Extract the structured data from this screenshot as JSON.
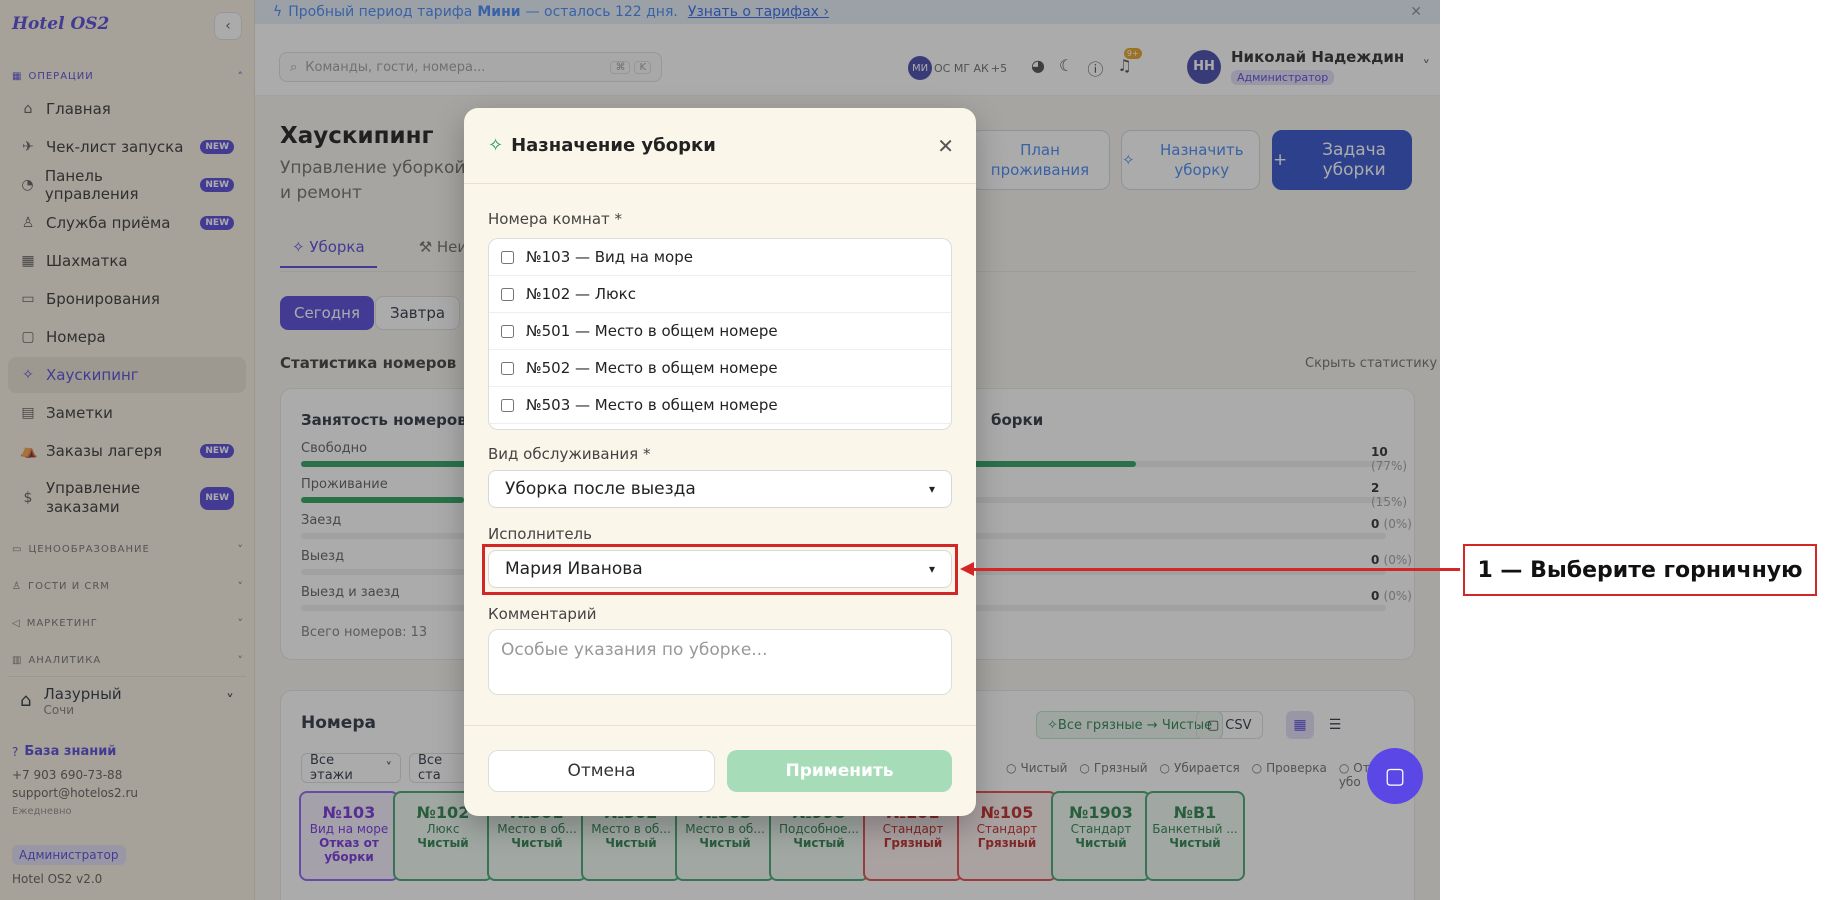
{
  "sidebar": {
    "logo": "Hotel OS2",
    "collapse": "‹",
    "sections": {
      "operations": "ОПЕРАЦИИ",
      "pricing": "ЦЕНООБРАЗОВАНИЕ",
      "guests": "ГОСТИ И CRM",
      "marketing": "МАРКЕТИНГ",
      "analytics": "АНАЛИТИКА"
    },
    "items": [
      {
        "label": "Главная",
        "icon": "⌂",
        "new": ""
      },
      {
        "label": "Чек-лист запуска",
        "icon": "✈",
        "new": "NEW"
      },
      {
        "label": "Панель управления",
        "icon": "◔",
        "new": "NEW"
      },
      {
        "label": "Служба приёма",
        "icon": "♙",
        "new": "NEW"
      },
      {
        "label": "Шахматка",
        "icon": "▦",
        "new": ""
      },
      {
        "label": "Бронирования",
        "icon": "▭",
        "new": ""
      },
      {
        "label": "Номера",
        "icon": "▢",
        "new": ""
      },
      {
        "label": "Хаускипинг",
        "icon": "✧",
        "new": ""
      },
      {
        "label": "Заметки",
        "icon": "▤",
        "new": ""
      },
      {
        "label": "Заказы лагеря",
        "icon": "⛺",
        "new": "NEW"
      },
      {
        "label": "Управление заказами",
        "icon": "$",
        "new": "NEW"
      }
    ],
    "hotel": {
      "name": "Лазурный",
      "city": "Сочи"
    },
    "kb": "База знаний",
    "phone": "+7 903 690-73-88",
    "email": "support@hotelos2.ru",
    "schedule": "Ежедневно",
    "role": "Администратор",
    "version": "Hotel OS2 v2.0"
  },
  "banner": {
    "text_a": "Пробный период тарифа",
    "plan": "Мини",
    "text_b": "— осталось 122 дня.",
    "link": "Узнать о тарифах ›",
    "close": "✕"
  },
  "topbar": {
    "search_placeholder": "Команды, гости, номера...",
    "kbd1": "⌘",
    "kbd2": "K",
    "avatars_a": "МИ",
    "avatars_b": "ОС МГ АК",
    "avatars_more": "+5",
    "notif_count": "9+",
    "user_initials": "НН",
    "user_name": "Николай Надеждин",
    "user_role": "Администратор"
  },
  "page": {
    "title": "Хаускипинг",
    "subtitle": "Управление уборкой и ремонт",
    "btn_plan": "План проживания",
    "btn_assign": "Назначить уборку",
    "btn_task": "Задача уборки",
    "tab_cleaning": "Уборка",
    "tab_repair": "Неи",
    "today": "Сегодня",
    "tomorrow": "Завтра",
    "stats_title": "Статистика номеров",
    "hide_stats": "Скрыть статистику",
    "occupancy_title": "Занятость номеров",
    "cleaning_title": "борки",
    "rows": [
      {
        "label": "Свободно",
        "value": "10",
        "pct": "(77%)",
        "fill": 0.77
      },
      {
        "label": "Проживание",
        "value": "2",
        "pct": "(15%)",
        "fill": 0.15
      },
      {
        "label": "Заезд",
        "value": "0",
        "pct": "(0%)",
        "fill": 0
      },
      {
        "label": "Выезд",
        "value": "0",
        "pct": "(0%)",
        "fill": 0
      },
      {
        "label": "Выезд и заезд",
        "value": "0",
        "pct": "(0%)",
        "fill": 0
      }
    ],
    "total_rooms": "Всего номеров: 13",
    "rooms_title": "Номера",
    "all_dirty": "Все грязные → Чистые",
    "csv": "CSV",
    "filter_floors": "Все этажи",
    "filter_status": "Все ста",
    "legend": [
      "Чистый",
      "Грязный",
      "Убирается",
      "Проверка",
      "Отказ от убо"
    ],
    "room_cards": [
      {
        "no": "№103",
        "type": "Вид на море",
        "status": "Отказ от уборки",
        "color": "purple"
      },
      {
        "no": "№102",
        "type": "Люкс",
        "status": "Чистый",
        "color": "green"
      },
      {
        "no": "№501",
        "type": "Место в об...",
        "status": "Чистый",
        "color": "green"
      },
      {
        "no": "№502",
        "type": "Место в об...",
        "status": "Чистый",
        "color": "green"
      },
      {
        "no": "№503",
        "type": "Место в об...",
        "status": "Чистый",
        "color": "green"
      },
      {
        "no": "№998",
        "type": "Подсобное...",
        "status": "Чистый",
        "color": "green"
      },
      {
        "no": "№101",
        "type": "Стандарт",
        "status": "Грязный",
        "color": "red"
      },
      {
        "no": "№105",
        "type": "Стандарт",
        "status": "Грязный",
        "color": "red"
      },
      {
        "no": "№1903",
        "type": "Стандарт",
        "status": "Чистый",
        "color": "green"
      },
      {
        "no": "№B1",
        "type": "Банкетный ...",
        "status": "Чистый",
        "color": "green"
      }
    ]
  },
  "modal": {
    "title": "Назначение уборки",
    "rooms_label": "Номера комнат *",
    "rooms": [
      "№103 — Вид на море",
      "№102 — Люкс",
      "№501 — Место в общем номере",
      "№502 — Место в общем номере",
      "№503 — Место в общем номере"
    ],
    "service_label": "Вид обслуживания *",
    "service_value": "Уборка после выезда",
    "assignee_label": "Исполнитель",
    "assignee_value": "Мария Иванова",
    "comment_label": "Комментарий",
    "comment_placeholder": "Особые указания по уборке...",
    "cancel": "Отмена",
    "apply": "Применить"
  },
  "annotation": {
    "callout": "1 — Выберите горничную"
  }
}
